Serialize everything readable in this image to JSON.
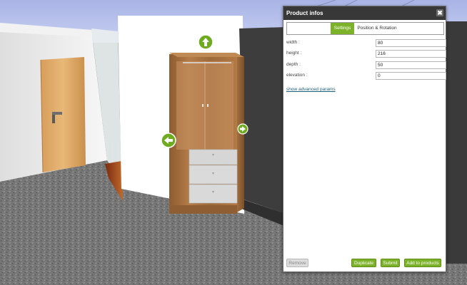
{
  "dialog": {
    "title": "Product infos",
    "close_glyph": "✖",
    "tabs": [
      "Settings",
      "Position & Rotation"
    ],
    "params": [
      {
        "label": "width :",
        "value": "80"
      },
      {
        "label": "height :",
        "value": "216"
      },
      {
        "label": "depth :",
        "value": "50"
      },
      {
        "label": "elevation :",
        "value": "0"
      }
    ],
    "advanced_link": "show advanced params",
    "buttons": {
      "remove": "Remove",
      "duplicate": "Duplicate",
      "submit": "Submit",
      "add": "Add to products"
    }
  },
  "scene": {
    "arrow_up_icon": "arrow-up-icon",
    "arrow_left_icon": "arrow-left-icon",
    "arrow_right_icon": "arrow-right-icon"
  },
  "colors": {
    "accent": "#7cb12a",
    "header": "#383838"
  }
}
